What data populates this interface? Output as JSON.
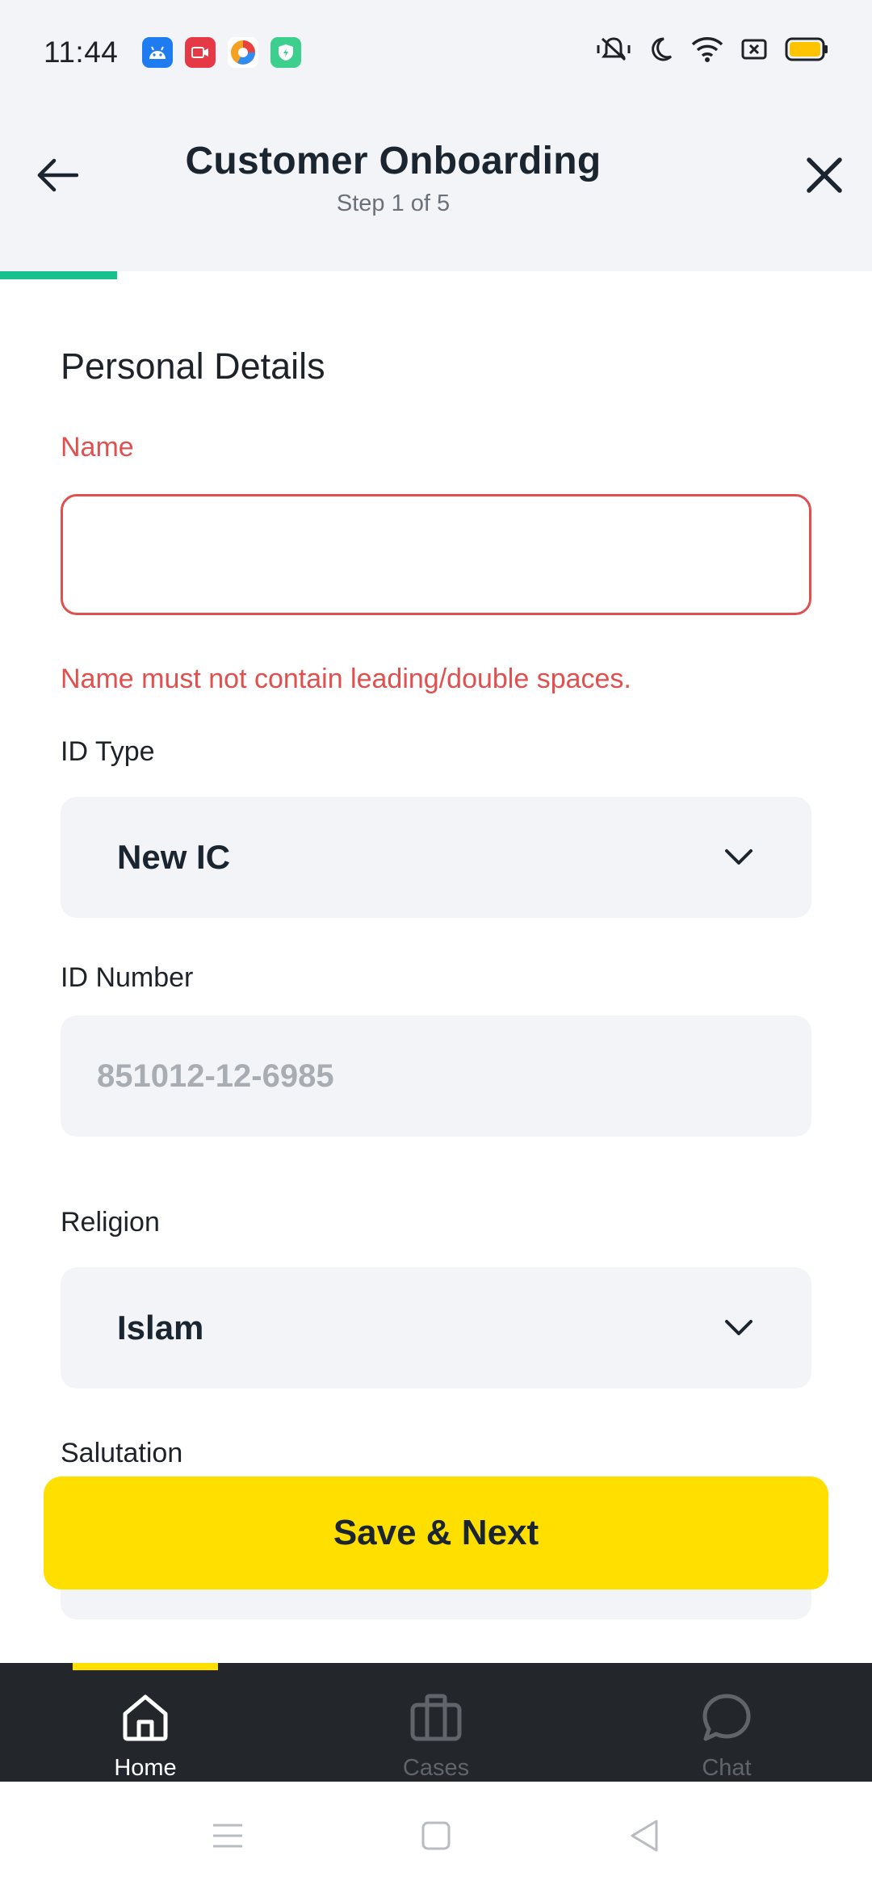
{
  "status_bar": {
    "time": "11:44",
    "notification_icons": [
      "android-app-icon",
      "screen-record-icon",
      "browser-app-icon",
      "shield-app-icon"
    ],
    "system_icons": [
      "vibrate-off-icon",
      "do-not-disturb-icon",
      "wifi-icon",
      "no-sim-icon",
      "battery-icon"
    ],
    "battery_color": "#ffc400"
  },
  "header": {
    "title": "Customer Onboarding",
    "subtitle": "Step 1 of 5",
    "progress": 0.2,
    "progress_color": "#1bbf8e"
  },
  "form": {
    "section_title": "Personal Details",
    "name": {
      "label": "Name",
      "value": "",
      "error": "Name must not contain leading/double spaces."
    },
    "id_type": {
      "label": "ID Type",
      "value": "New IC"
    },
    "id_number": {
      "label": "ID Number",
      "placeholder": "851012-12-6985"
    },
    "religion": {
      "label": "Religion",
      "value": "Islam"
    },
    "salutation": {
      "label": "Salutation"
    }
  },
  "actions": {
    "save_next_label": "Save & Next",
    "accent_color": "#ffdf00"
  },
  "bottom_nav": {
    "items": [
      {
        "label": "Home",
        "icon": "home-icon",
        "active": true
      },
      {
        "label": "Cases",
        "icon": "briefcase-icon",
        "active": false
      },
      {
        "label": "Chat",
        "icon": "chat-bubble-icon",
        "active": false
      }
    ]
  },
  "system_nav": [
    "menu-icon",
    "home-square-icon",
    "back-triangle-icon"
  ]
}
